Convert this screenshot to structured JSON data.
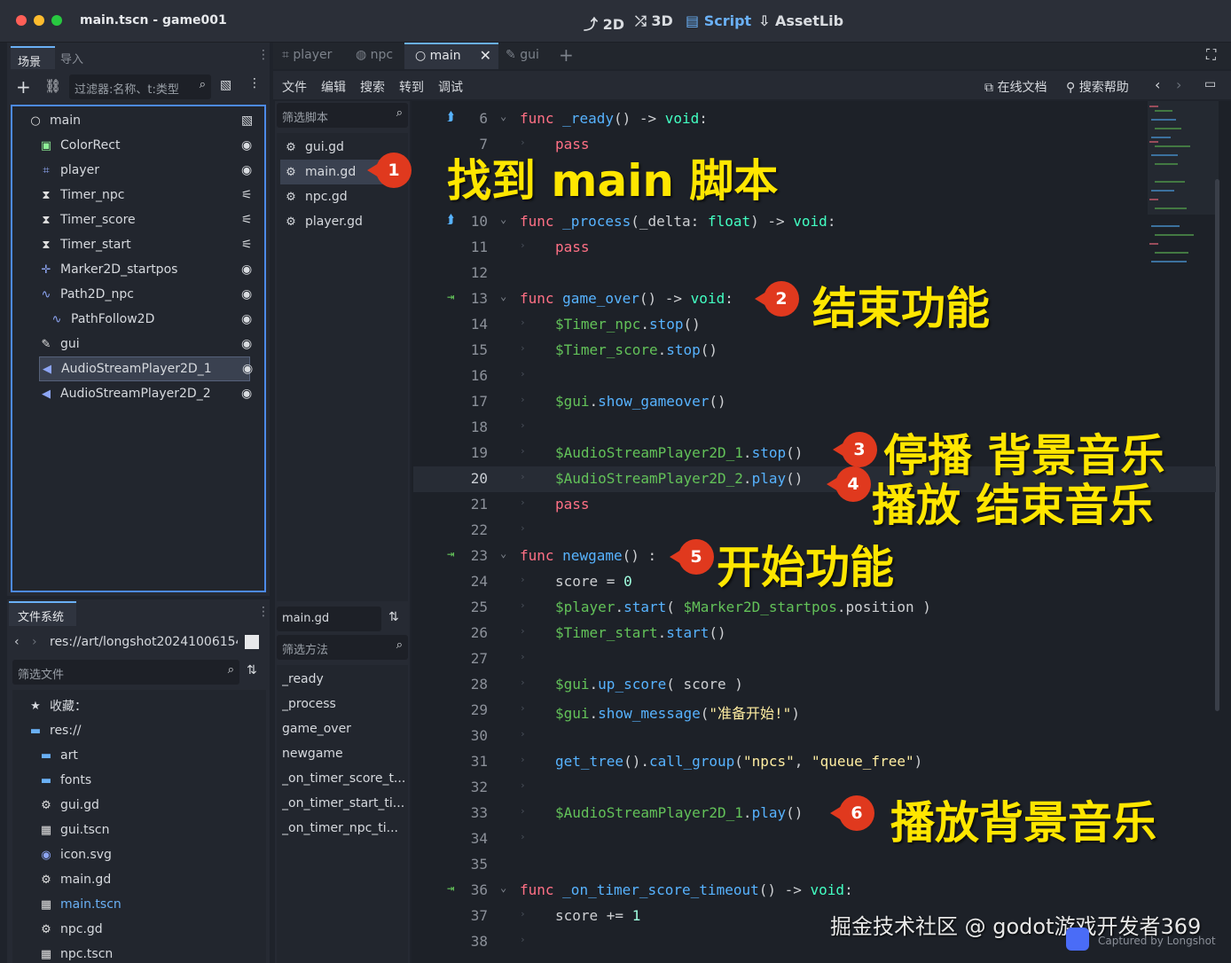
{
  "window": {
    "title": "main.tscn - game001"
  },
  "modes": [
    {
      "icon": "2d-icon",
      "label": "2D"
    },
    {
      "icon": "3d-icon",
      "label": "3D"
    },
    {
      "icon": "script-icon",
      "label": "Script"
    },
    {
      "icon": "assetlib-icon",
      "label": "AssetLib"
    }
  ],
  "scene_dock": {
    "tabs": [
      "场景",
      "导入"
    ],
    "filter_placeholder": "过滤器:名称、t:类型",
    "nodes": [
      {
        "label": "main",
        "icon": "node-icon"
      },
      {
        "label": "ColorRect",
        "icon": "colorrect-icon"
      },
      {
        "label": "player",
        "icon": "player-icon"
      },
      {
        "label": "Timer_npc",
        "icon": "timer-icon"
      },
      {
        "label": "Timer_score",
        "icon": "timer-icon"
      },
      {
        "label": "Timer_start",
        "icon": "timer-icon"
      },
      {
        "label": "Marker2D_startpos",
        "icon": "marker-icon"
      },
      {
        "label": "Path2D_npc",
        "icon": "path-icon"
      },
      {
        "label": "PathFollow2D",
        "icon": "pathfollow-icon"
      },
      {
        "label": "gui",
        "icon": "gui-icon"
      },
      {
        "label": "AudioStreamPlayer2D_1",
        "icon": "audio-icon"
      },
      {
        "label": "AudioStreamPlayer2D_2",
        "icon": "audio-icon"
      }
    ]
  },
  "filesystem": {
    "tab": "文件系统",
    "path": "res://art/longshot20241006154",
    "filter_placeholder": "筛选文件",
    "favorites": "收藏：",
    "items": [
      {
        "label": "res://",
        "icon": "folder-icon"
      },
      {
        "label": "art",
        "icon": "folder-icon"
      },
      {
        "label": "fonts",
        "icon": "folder-icon"
      },
      {
        "label": "gui.gd",
        "icon": "gear-icon"
      },
      {
        "label": "gui.tscn",
        "icon": "scene-icon"
      },
      {
        "label": "icon.svg",
        "icon": "image-icon"
      },
      {
        "label": "main.gd",
        "icon": "gear-icon"
      },
      {
        "label": "main.tscn",
        "icon": "scene-icon"
      },
      {
        "label": "npc.gd",
        "icon": "gear-icon"
      },
      {
        "label": "npc.tscn",
        "icon": "scene-icon"
      }
    ]
  },
  "editor_tabs": [
    "player",
    "npc",
    "main",
    "gui"
  ],
  "menu": [
    "文件",
    "编辑",
    "搜索",
    "转到",
    "调试"
  ],
  "help": {
    "docs": "在线文档",
    "search_help": "搜索帮助"
  },
  "script_list": {
    "filter_placeholder": "筛选脚本",
    "items": [
      "gui.gd",
      "main.gd",
      "npc.gd",
      "player.gd"
    ],
    "current": "main.gd",
    "method_filter_placeholder": "筛选方法",
    "methods": [
      "_ready",
      "_process",
      "game_over",
      "newgame",
      "_on_timer_score_t...",
      "_on_timer_start_ti...",
      "_on_timer_npc_ti..."
    ]
  },
  "code": [
    {
      "n": "6",
      "fold": true,
      "marker": "override",
      "toks": [
        [
          "kw",
          "func "
        ],
        [
          "fn",
          "_ready"
        ],
        [
          "tx",
          "() -> "
        ],
        [
          "ty",
          "void"
        ],
        [
          "tx",
          ":"
        ]
      ]
    },
    {
      "n": "7",
      "toks": [
        [
          "kw",
          "pass"
        ]
      ],
      "ind": 1
    },
    {
      "n": "8",
      "toks": []
    },
    {
      "n": "9",
      "toks": []
    },
    {
      "n": "10",
      "fold": true,
      "marker": "override",
      "toks": [
        [
          "kw",
          "func "
        ],
        [
          "fn",
          "_process"
        ],
        [
          "tx",
          "(_delta: "
        ],
        [
          "ty",
          "float"
        ],
        [
          "tx",
          ") -> "
        ],
        [
          "ty",
          "void"
        ],
        [
          "tx",
          ":"
        ]
      ]
    },
    {
      "n": "11",
      "toks": [
        [
          "kw",
          "pass"
        ]
      ],
      "ind": 1
    },
    {
      "n": "12",
      "toks": []
    },
    {
      "n": "13",
      "fold": true,
      "marker": "signal",
      "toks": [
        [
          "kw",
          "func "
        ],
        [
          "fn",
          "game_over"
        ],
        [
          "tx",
          "() -> "
        ],
        [
          "ty",
          "void"
        ],
        [
          "tx",
          ":"
        ]
      ]
    },
    {
      "n": "14",
      "ind": 1,
      "toks": [
        [
          "nd",
          "$Timer_npc"
        ],
        [
          "tx",
          "."
        ],
        [
          "fn",
          "stop"
        ],
        [
          "tx",
          "()"
        ]
      ]
    },
    {
      "n": "15",
      "ind": 1,
      "toks": [
        [
          "nd",
          "$Timer_score"
        ],
        [
          "tx",
          "."
        ],
        [
          "fn",
          "stop"
        ],
        [
          "tx",
          "()"
        ]
      ]
    },
    {
      "n": "16",
      "ind": 1,
      "toks": []
    },
    {
      "n": "17",
      "ind": 1,
      "toks": [
        [
          "nd",
          "$gui"
        ],
        [
          "tx",
          "."
        ],
        [
          "fn",
          "show_gameover"
        ],
        [
          "tx",
          "()"
        ]
      ]
    },
    {
      "n": "18",
      "ind": 1,
      "toks": []
    },
    {
      "n": "19",
      "ind": 1,
      "toks": [
        [
          "nd",
          "$AudioStreamPlayer2D_1"
        ],
        [
          "tx",
          "."
        ],
        [
          "fn",
          "stop"
        ],
        [
          "tx",
          "()"
        ]
      ]
    },
    {
      "n": "20",
      "ind": 1,
      "current": true,
      "toks": [
        [
          "nd",
          "$AudioStreamPlayer2D_2"
        ],
        [
          "tx",
          "."
        ],
        [
          "fn",
          "play"
        ],
        [
          "tx",
          "()"
        ]
      ]
    },
    {
      "n": "21",
      "ind": 1,
      "toks": [
        [
          "kw",
          "pass"
        ]
      ]
    },
    {
      "n": "22",
      "ind": 1,
      "toks": []
    },
    {
      "n": "23",
      "fold": true,
      "marker": "signal",
      "toks": [
        [
          "kw",
          "func "
        ],
        [
          "fn",
          "newgame"
        ],
        [
          "tx",
          "() :"
        ]
      ]
    },
    {
      "n": "24",
      "ind": 1,
      "toks": [
        [
          "tx",
          "score = "
        ],
        [
          "nm",
          "0"
        ]
      ]
    },
    {
      "n": "25",
      "ind": 1,
      "toks": [
        [
          "nd",
          "$player"
        ],
        [
          "tx",
          "."
        ],
        [
          "fn",
          "start"
        ],
        [
          "tx",
          "( "
        ],
        [
          "nd",
          "$Marker2D_startpos"
        ],
        [
          "tx",
          ".position )"
        ]
      ]
    },
    {
      "n": "26",
      "ind": 1,
      "toks": [
        [
          "nd",
          "$Timer_start"
        ],
        [
          "tx",
          "."
        ],
        [
          "fn",
          "start"
        ],
        [
          "tx",
          "()"
        ]
      ]
    },
    {
      "n": "27",
      "ind": 1,
      "toks": []
    },
    {
      "n": "28",
      "ind": 1,
      "toks": [
        [
          "nd",
          "$gui"
        ],
        [
          "tx",
          "."
        ],
        [
          "fn",
          "up_score"
        ],
        [
          "tx",
          "( score )"
        ]
      ]
    },
    {
      "n": "29",
      "ind": 1,
      "toks": [
        [
          "nd",
          "$gui"
        ],
        [
          "tx",
          "."
        ],
        [
          "fn",
          "show_message"
        ],
        [
          "tx",
          "("
        ],
        [
          "st",
          "\"准备开始!\""
        ],
        [
          "tx",
          ")"
        ]
      ]
    },
    {
      "n": "30",
      "ind": 1,
      "toks": []
    },
    {
      "n": "31",
      "ind": 1,
      "toks": [
        [
          "fn",
          "get_tree"
        ],
        [
          "tx",
          "()."
        ],
        [
          "fn",
          "call_group"
        ],
        [
          "tx",
          "("
        ],
        [
          "st",
          "\"npcs\""
        ],
        [
          "tx",
          ", "
        ],
        [
          "st",
          "\"queue_free\""
        ],
        [
          "tx",
          ")"
        ]
      ]
    },
    {
      "n": "32",
      "ind": 1,
      "toks": []
    },
    {
      "n": "33",
      "ind": 1,
      "toks": [
        [
          "nd",
          "$AudioStreamPlayer2D_1"
        ],
        [
          "tx",
          "."
        ],
        [
          "fn",
          "play"
        ],
        [
          "tx",
          "()"
        ]
      ]
    },
    {
      "n": "34",
      "ind": 1,
      "toks": []
    },
    {
      "n": "35",
      "toks": []
    },
    {
      "n": "36",
      "fold": true,
      "marker": "signal",
      "toks": [
        [
          "kw",
          "func "
        ],
        [
          "fn",
          "_on_timer_score_timeout"
        ],
        [
          "tx",
          "() -> "
        ],
        [
          "ty",
          "void"
        ],
        [
          "tx",
          ":"
        ]
      ]
    },
    {
      "n": "37",
      "ind": 1,
      "toks": [
        [
          "tx",
          "score += "
        ],
        [
          "nm",
          "1"
        ]
      ]
    },
    {
      "n": "38",
      "ind": 1,
      "toks": []
    }
  ],
  "annotations": [
    {
      "n": "1",
      "text": "找到 main 脚本"
    },
    {
      "n": "2",
      "text": "结束功能"
    },
    {
      "n": "3",
      "text": "停播 背景音乐"
    },
    {
      "n": "4",
      "text": "播放 结束音乐"
    },
    {
      "n": "5",
      "text": "开始功能"
    },
    {
      "n": "6",
      "text": "播放背景音乐"
    }
  ],
  "watermark": {
    "main": "掘金技术社区 @ godot游戏开发者369",
    "sub": "Captured by Longshot"
  },
  "colors": {
    "accent": "#6ab0f5",
    "badge": "#e0391e",
    "annotation": "#ffe600",
    "keyword": "#ff7085",
    "function": "#57b3ff",
    "type": "#42ffc2",
    "node_path": "#63c259",
    "string": "#ffeda1"
  }
}
